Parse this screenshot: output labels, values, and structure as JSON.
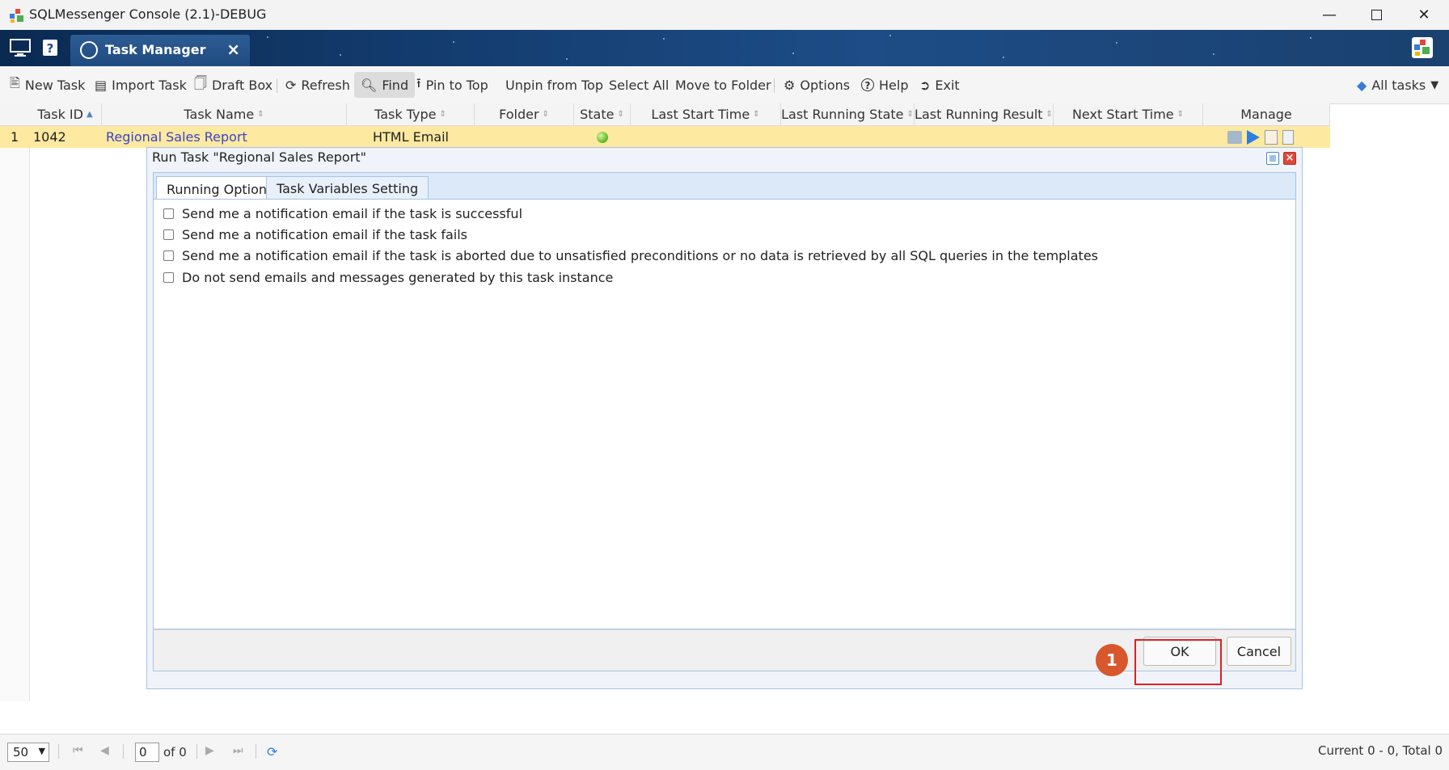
{
  "window": {
    "title": "SQLMessenger Console (2.1)-DEBUG"
  },
  "tab": {
    "label": "Task Manager"
  },
  "toolbar": {
    "new_task": "New Task",
    "import_task": "Import Task",
    "draft_box": "Draft Box",
    "refresh": "Refresh",
    "find": "Find",
    "pin_to_top": "Pin to Top",
    "unpin_from_top": "Unpin from Top",
    "select_all": "Select All",
    "move_to_folder": "Move to Folder",
    "options": "Options",
    "help": "Help",
    "exit": "Exit",
    "filter": "All tasks"
  },
  "grid": {
    "columns": [
      "Task ID",
      "Task Name",
      "Task Type",
      "Folder",
      "State",
      "Last Start Time",
      "Last Running State",
      "Last Running Result",
      "Next Start Time",
      "Manage"
    ],
    "rows": [
      {
        "num": "1",
        "id": "1042",
        "name": "Regional Sales Report",
        "type": "HTML Email",
        "folder": "",
        "state": "green-dot"
      }
    ]
  },
  "dialog": {
    "title": "Run Task \"Regional Sales Report\"",
    "tabs": [
      "Running Options",
      "Task Variables Setting"
    ],
    "options": [
      "Send me a notification email if the task is successful",
      "Send me a notification email if the task fails",
      "Send me a notification email if the task is aborted due to unsatisfied preconditions or no data is retrieved by all SQL queries in the templates",
      "Do not send emails and messages generated by this task instance"
    ],
    "ok": "OK",
    "cancel": "Cancel",
    "step_badge": "1"
  },
  "pager": {
    "page_size": "50",
    "page": "0",
    "of_total": "of 0",
    "info": "Current 0 - 0, Total 0"
  },
  "colors": {
    "accent": "#1d4c86",
    "highlight_row": "#fde9a0",
    "annotation": "#e02020",
    "badge": "#d9572c"
  }
}
